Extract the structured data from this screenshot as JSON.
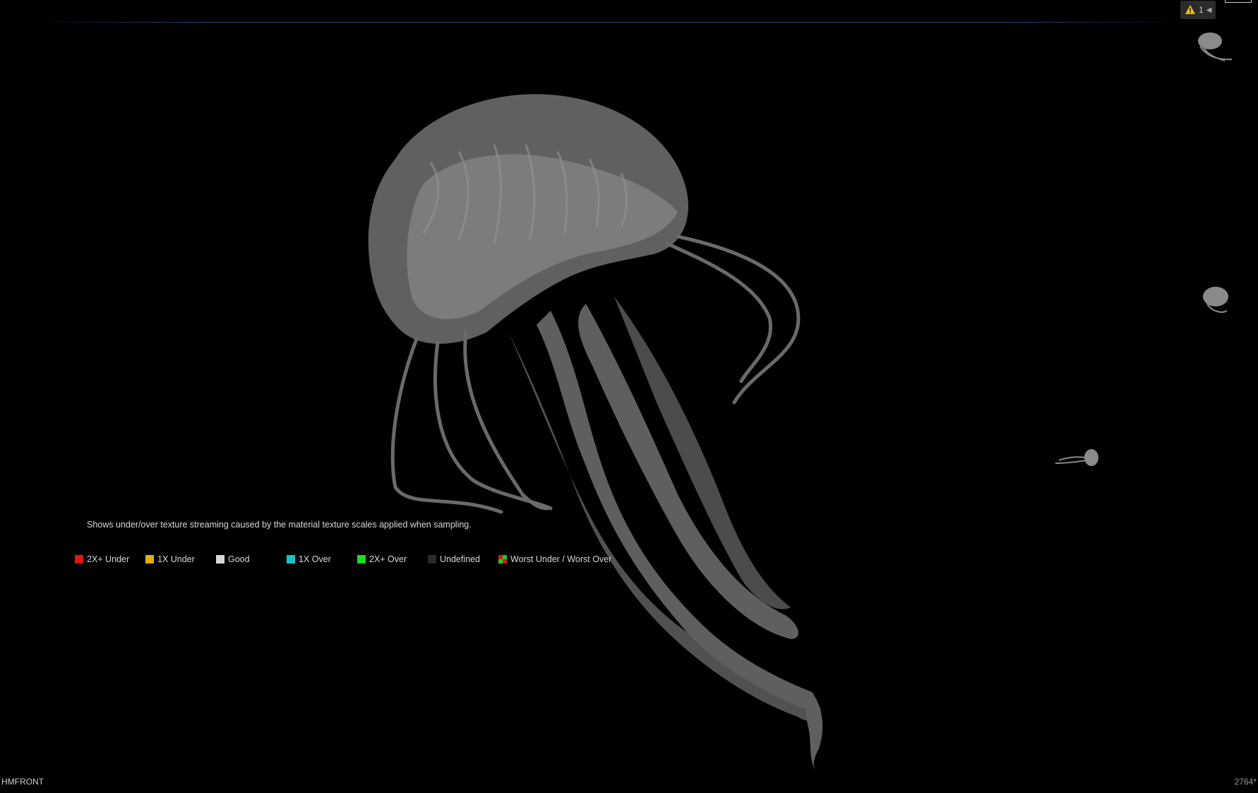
{
  "viewport": {
    "warning_count": "1",
    "description": "Shows under/over texture streaming caused by the material texture scales applied when sampling.",
    "legend": [
      {
        "label": "2X+ Under",
        "color": "#e01616",
        "icon": "red-swatch"
      },
      {
        "label": "1X Under",
        "color": "#e0b016",
        "icon": "yellow-swatch"
      },
      {
        "label": "Good",
        "color": "#d6d6d6",
        "icon": "white-swatch"
      },
      {
        "label": "1X Over",
        "color": "#15c4c4",
        "icon": "cyan-swatch"
      },
      {
        "label": "2X+ Over",
        "color": "#1edc1e",
        "icon": "green-swatch"
      },
      {
        "label": "Undefined",
        "color": "#2a2a2a",
        "icon": "dark-swatch"
      },
      {
        "label": "Worst Under / Worst Over",
        "color": "checker",
        "icon": "red-green-checker-swatch"
      }
    ],
    "bottom_left_label": "HMFRONT",
    "bottom_right_label": "2764*"
  },
  "colors": {
    "background": "#000000",
    "jellyfish": "#7a7a7a",
    "accent_line": "#1f4a86"
  }
}
